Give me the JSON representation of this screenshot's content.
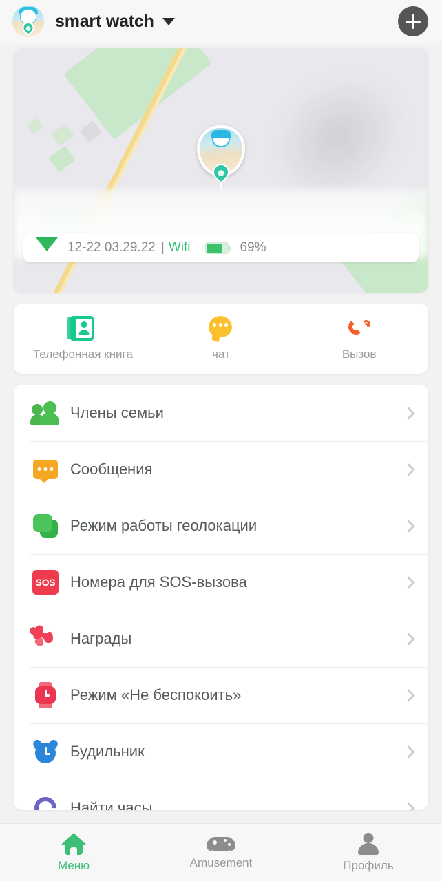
{
  "header": {
    "title": "smart watch",
    "avatar_name": "device-avatar",
    "dropdown_icon": "chevron-down-icon",
    "add_label": "+"
  },
  "map": {
    "pin_label": "device-location-pin",
    "status": {
      "timestamp": "12-22 03.29.22",
      "separator": "|",
      "connection": "Wifi",
      "battery_percent": "69%",
      "battery_level": 69
    }
  },
  "quick_actions": [
    {
      "label": "Телефонная книга",
      "icon": "phonebook-icon",
      "color": "#17c98c"
    },
    {
      "label": "чат",
      "icon": "chat-bubble-icon",
      "color": "#fbc02d"
    },
    {
      "label": "Вызов",
      "icon": "phone-call-icon",
      "color": "#f4602a"
    }
  ],
  "menu": [
    {
      "label": "Члены семьи",
      "icon": "family-members-icon",
      "color": "#4cbf52"
    },
    {
      "label": "Сообщения",
      "icon": "messages-icon",
      "color": "#f5a623"
    },
    {
      "label": "Режим работы геолокации",
      "icon": "geolocation-mode-icon",
      "color": "#4cc45b"
    },
    {
      "label": "Номера для SOS-вызова",
      "icon": "sos-icon",
      "color": "#ef3b4e",
      "badge_text": "SOS"
    },
    {
      "label": "Награды",
      "icon": "rewards-hearts-icon",
      "color": "#ef4056"
    },
    {
      "label": "Режим «Не беспокоить»",
      "icon": "do-not-disturb-watch-icon",
      "color": "#ec3550"
    },
    {
      "label": "Будильник",
      "icon": "alarm-clock-icon",
      "color": "#2a86d8"
    },
    {
      "label": "Найти часы",
      "icon": "find-watch-icon",
      "color": "#6c63c8"
    }
  ],
  "bottom_nav": [
    {
      "label": "Меню",
      "icon": "home-icon",
      "active": true
    },
    {
      "label": "Amusement",
      "icon": "gamepad-icon",
      "active": false
    },
    {
      "label": "Профиль",
      "icon": "user-profile-icon",
      "active": false
    }
  ],
  "colors": {
    "accent_green": "#3dbf77",
    "page_background": "#f2f2f2",
    "card_background": "#ffffff",
    "text_primary": "#555a5e",
    "text_muted": "#9a9a9a"
  }
}
